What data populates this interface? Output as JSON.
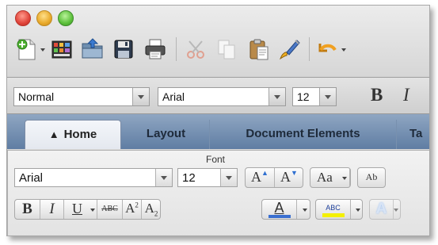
{
  "window": {
    "controls": [
      {
        "name": "close-button",
        "color": "#e0443a"
      },
      {
        "name": "minimize-button",
        "color": "#e8a92a"
      },
      {
        "name": "maximize-button",
        "color": "#5bbf3a"
      }
    ]
  },
  "toolbar": {
    "icons": [
      "new-document-icon",
      "templates-icon",
      "open-icon",
      "save-icon",
      "print-icon",
      "cut-icon",
      "copy-icon",
      "paste-icon",
      "format-painter-icon",
      "undo-icon"
    ]
  },
  "formatbar": {
    "style_value": "Normal",
    "font_value": "Arial",
    "size_value": "12",
    "bold_label": "B",
    "italic_label": "I"
  },
  "ribbon": {
    "tabs": [
      "Home",
      "Layout",
      "Document Elements",
      "Ta"
    ],
    "active_tab": "Home"
  },
  "font_group": {
    "title": "Font",
    "font_value": "Arial",
    "size_value": "12",
    "grow_label": "A",
    "shrink_label": "A",
    "case_label": "Aa",
    "clear_label": "Ab",
    "bold_label": "B",
    "italic_label": "I",
    "underline_label": "U",
    "strike_label": "ABC",
    "superscript_base": "A",
    "superscript_mark": "2",
    "subscript_base": "A",
    "subscript_mark": "2",
    "font_color_label": "A",
    "highlight_label": "ABC",
    "text_effects_label": "A",
    "font_color_swatch": "#3a6fd0",
    "highlight_swatch": "#f4f000"
  }
}
